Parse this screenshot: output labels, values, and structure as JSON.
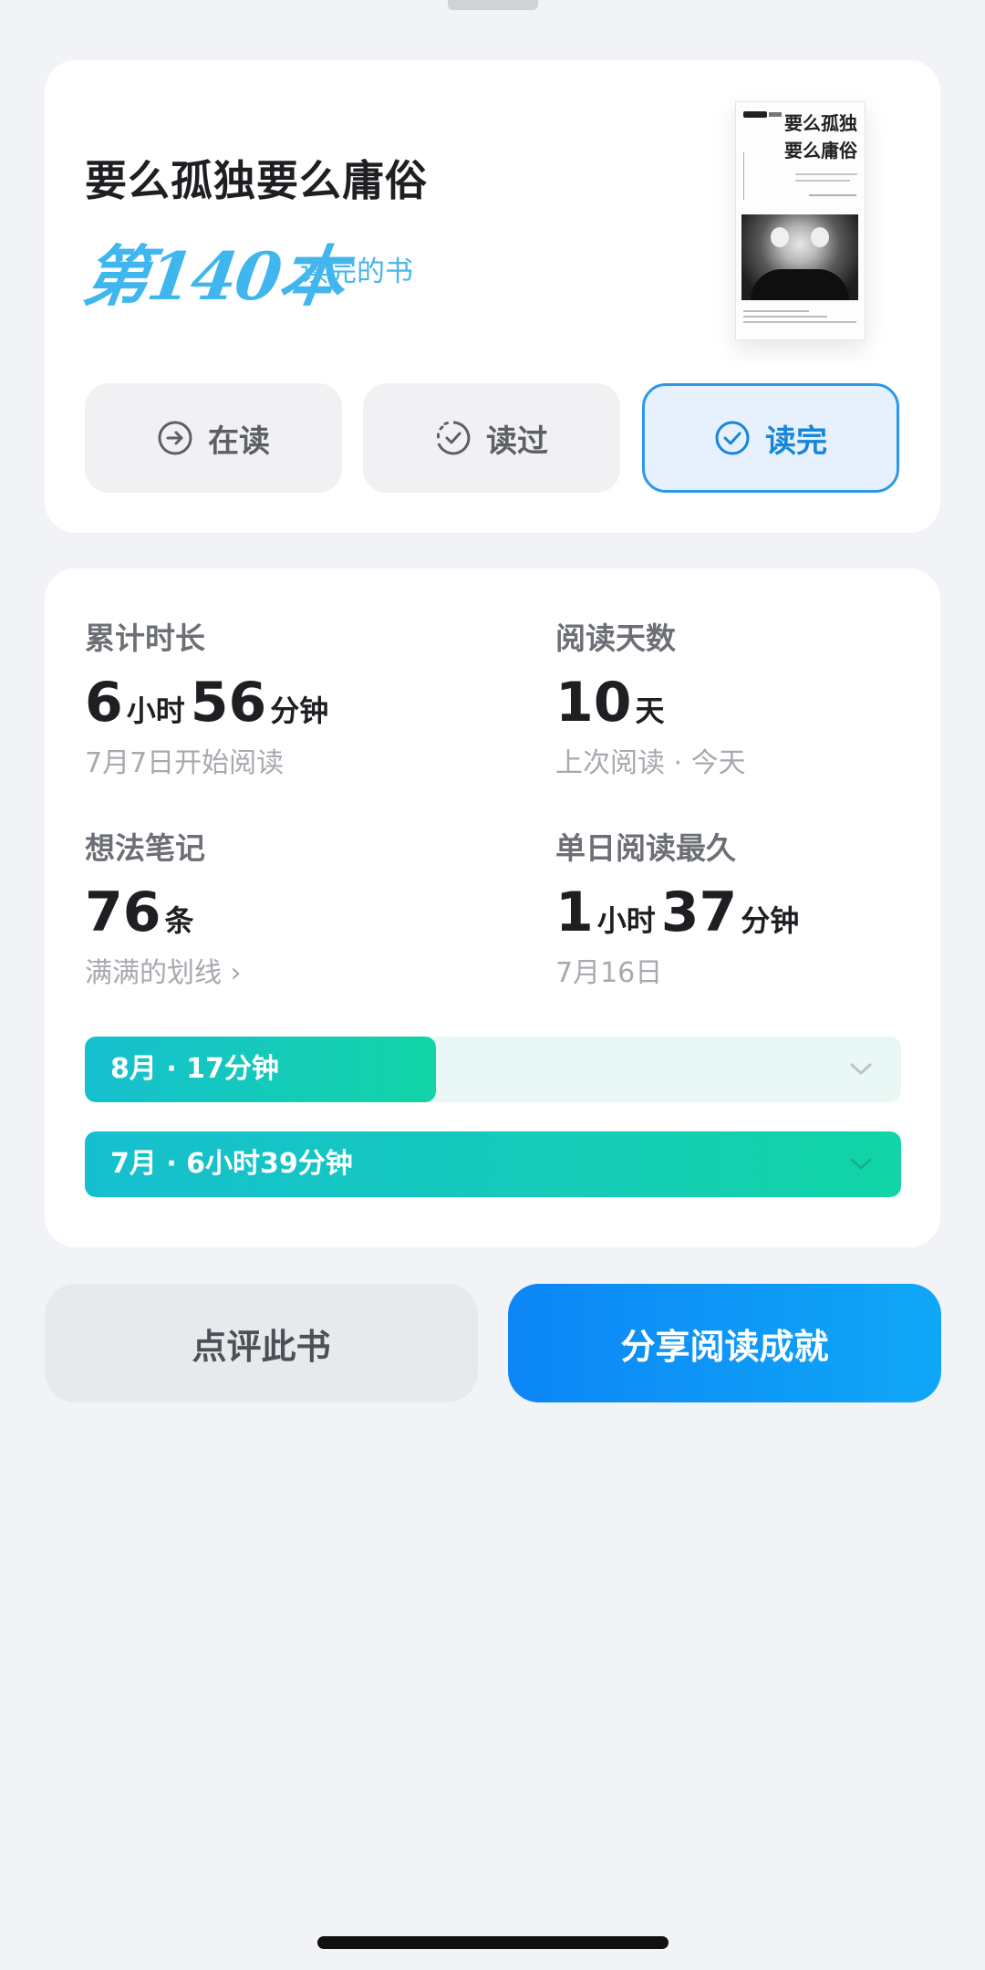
{
  "book": {
    "title": "要么孤独要么庸俗",
    "rank_number": "第140本",
    "rank_suffix": "读完的书",
    "cover_title_line1": "要么孤独",
    "cover_title_line2": "要么庸俗"
  },
  "status_buttons": [
    {
      "label": "在读",
      "icon": "arrow-circle-right-icon",
      "selected": false
    },
    {
      "label": "读过",
      "icon": "dashed-check-circle-icon",
      "selected": false
    },
    {
      "label": "读完",
      "icon": "check-circle-icon",
      "selected": true
    }
  ],
  "stats": {
    "total_time": {
      "label": "累计时长",
      "hours": "6",
      "hours_unit": "小时",
      "minutes": "56",
      "minutes_unit": "分钟",
      "sub": "7月7日开始阅读"
    },
    "reading_days": {
      "label": "阅读天数",
      "value": "10",
      "unit": "天",
      "sub": "上次阅读 · 今天"
    },
    "notes": {
      "label": "想法笔记",
      "value": "76",
      "unit": "条",
      "sub": "满满的划线 ›"
    },
    "longest_day": {
      "label": "单日阅读最久",
      "hours": "1",
      "hours_unit": "小时",
      "minutes": "37",
      "minutes_unit": "分钟",
      "sub": "7月16日"
    }
  },
  "months": [
    {
      "label": "8月 · 17分钟",
      "fill_fraction": 0.43
    },
    {
      "label": "7月 · 6小时39分钟",
      "fill_fraction": 1.0
    }
  ],
  "actions": {
    "review_label": "点评此书",
    "share_label": "分享阅读成就"
  },
  "colors": {
    "accent_blue": "#2b98ea",
    "progress_start": "#16bfd0",
    "progress_end": "#12d4a6",
    "share_button": "#0c86f6"
  }
}
